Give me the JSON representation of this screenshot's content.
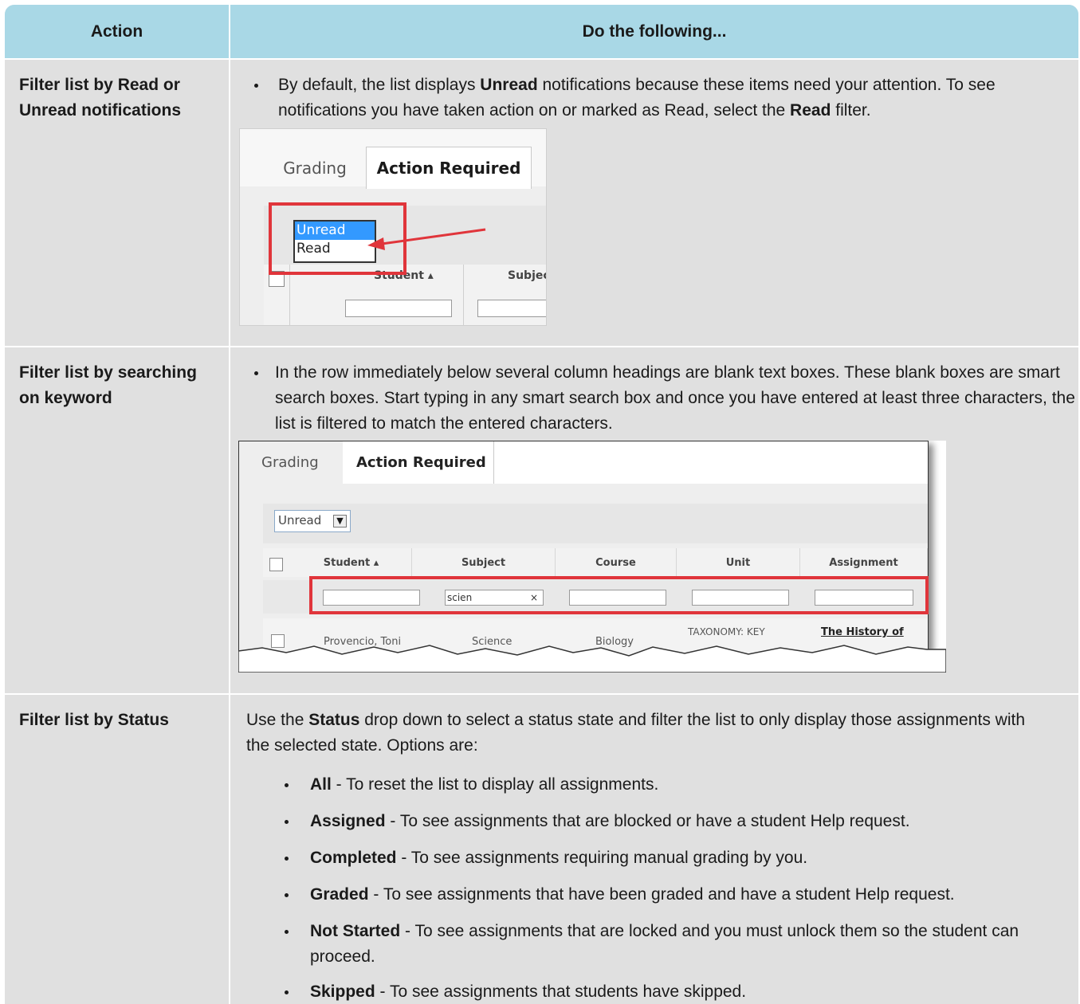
{
  "header": {
    "col_action": "Action",
    "col_do": "Do the following..."
  },
  "rows": [
    {
      "action": "Filter list by Read or Unread notifications",
      "bullet": {
        "t1": "By default, the list displays ",
        "b1": "Unread",
        "t2": " notifications because these items need your attention. To see notifications you have taken action on or marked as Read, select the ",
        "b2": "Read",
        "t3": " filter."
      },
      "screenshot": {
        "tabs": [
          "Grading",
          "Action Required"
        ],
        "options": [
          "Unread",
          "Read"
        ],
        "columns": [
          "Student",
          "Subjec"
        ]
      }
    },
    {
      "action": "Filter list by searching on keyword",
      "bullet": "In the row immediately below several column headings are blank text boxes. These blank boxes are smart search boxes. Start typing in any smart search box and once you have entered at least three characters, the list is filtered to match the entered characters.",
      "screenshot": {
        "tabs": [
          "Grading",
          "Action Required"
        ],
        "filter_value": "Unread",
        "columns": [
          "Student",
          "Subject",
          "Course",
          "Unit",
          "Assignment"
        ],
        "search_value": "scien",
        "clear_glyph": "×",
        "row": [
          "Provencio, Toni",
          "Science",
          "Biology",
          "TAXONOMY: KEY",
          "The History of"
        ]
      }
    },
    {
      "action": "Filter list by Status",
      "intro": {
        "t1": "Use the ",
        "b1": "Status",
        "t2": " drop down to select a status state and filter the list to only display those assignments with the selected state. Options are:"
      },
      "options": [
        {
          "name": "All",
          "desc": " - To reset the list to display all assignments."
        },
        {
          "name": "Assigned",
          "desc": " - To see assignments that are blocked or have a student Help request."
        },
        {
          "name": "Completed",
          "desc": " - To see assignments requiring manual grading by you."
        },
        {
          "name": "Graded",
          "desc": " - To see assignments that have been graded and have a student Help request."
        },
        {
          "name": "Not Started",
          "desc": " - To see assignments that are locked and you must unlock them so the student can proceed."
        },
        {
          "name": "Skipped",
          "desc": " - To see assignments that students have skipped."
        }
      ]
    }
  ],
  "colors": {
    "header_bg": "#a9d8e6",
    "row_bg": "#e0e0e0",
    "highlight_red": "#e0353b"
  }
}
